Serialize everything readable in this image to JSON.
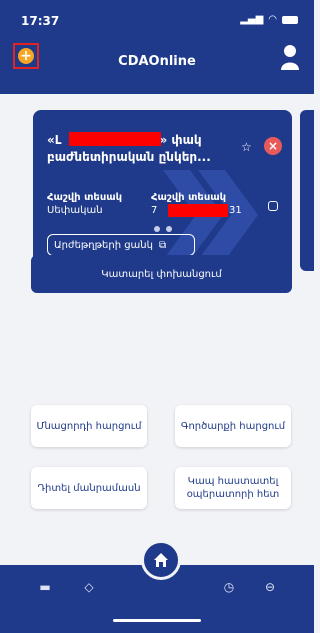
{
  "status_bar": {
    "time": "17:37"
  },
  "header": {
    "title": "CDAOnline",
    "add_button": "+"
  },
  "account_card": {
    "name_prefix": "«Լ",
    "name_suffix": "» փակ",
    "name_line2": "բաժնետիրական ընկեր...",
    "account_type_label": "Հաշվի տեսակ",
    "account_type_value": "Սեփական",
    "account_number_label": "Հաշվի տեսակ",
    "account_number_prefix": "7",
    "account_number_suffix": "31",
    "securities_list_button": "Արժեթղթերի ցանկ"
  },
  "carousel": {
    "pages": 3,
    "active": 0
  },
  "actions": {
    "transfer": "Կատարել փոխանցում",
    "balance_inquiry": "Մնացորդի հարցում",
    "transaction_inquiry": "Գործարքի հարցում",
    "view_details": "Դիտել մանրամասն",
    "contact_operator": "Կապ հաստատել օպերատորի հետ"
  },
  "tabbar": {
    "items": [
      "card-icon",
      "chart-icon",
      "home-icon",
      "history-icon",
      "menu-icon"
    ],
    "active": "home-icon"
  },
  "colors": {
    "brand": "#1f3a8a",
    "accent": "#f5a623",
    "close": "#e85a5a"
  }
}
